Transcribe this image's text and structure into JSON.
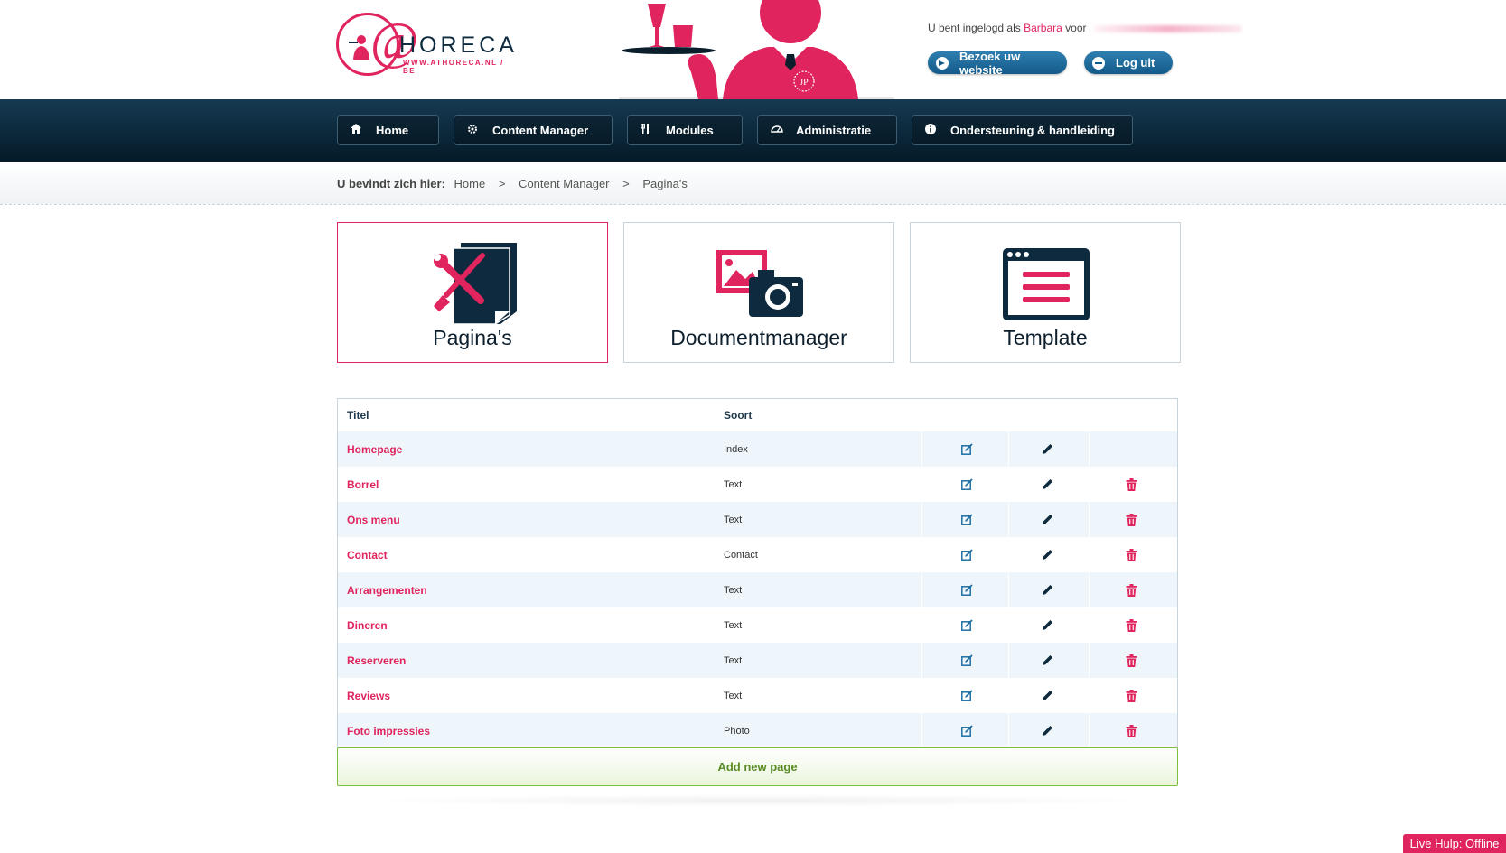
{
  "logo": {
    "brand": "HORECA",
    "tagline": "WWW.ATHORECA.NL / BE"
  },
  "mascot": {
    "badge": "JP"
  },
  "login": {
    "prefix": "U bent ingelogd als",
    "user": "Barbara",
    "suffix": "voor"
  },
  "header_buttons": {
    "website": "Bezoek uw website",
    "logout": "Log uit"
  },
  "nav": [
    {
      "label": "Home",
      "icon": "home-icon"
    },
    {
      "label": "Content Manager",
      "icon": "gear-icon"
    },
    {
      "label": "Modules",
      "icon": "fork-knife-icon"
    },
    {
      "label": "Administratie",
      "icon": "dashboard-icon"
    },
    {
      "label": "Ondersteuning & handleiding",
      "icon": "info-icon"
    }
  ],
  "breadcrumb": {
    "lead": "U bevindt zich hier:",
    "items": [
      "Home",
      "Content Manager",
      "Pagina's"
    ],
    "separator": ">"
  },
  "tiles": [
    {
      "label": "Pagina's",
      "icon": "tools-page-icon",
      "active": true
    },
    {
      "label": "Documentmanager",
      "icon": "camera-images-icon",
      "active": false
    },
    {
      "label": "Template",
      "icon": "browser-window-icon",
      "active": false
    }
  ],
  "table": {
    "headers": {
      "title": "Titel",
      "kind": "Soort"
    },
    "rows": [
      {
        "title": "Homepage",
        "kind": "Index",
        "deletable": false
      },
      {
        "title": "Borrel",
        "kind": "Text",
        "deletable": true
      },
      {
        "title": "Ons menu",
        "kind": "Text",
        "deletable": true
      },
      {
        "title": "Contact",
        "kind": "Contact",
        "deletable": true
      },
      {
        "title": "Arrangementen",
        "kind": "Text",
        "deletable": true
      },
      {
        "title": "Dineren",
        "kind": "Text",
        "deletable": true
      },
      {
        "title": "Reserveren",
        "kind": "Text",
        "deletable": true
      },
      {
        "title": "Reviews",
        "kind": "Text",
        "deletable": true
      },
      {
        "title": "Foto impressies",
        "kind": "Photo",
        "deletable": true
      }
    ],
    "add_label": "Add new page"
  },
  "live_help": "Live Hulp: Offline",
  "colors": {
    "accent": "#e0245e",
    "navy": "#0d2a3e",
    "button_blue": "#1f6fa3",
    "add_green": "#5a8a26"
  }
}
